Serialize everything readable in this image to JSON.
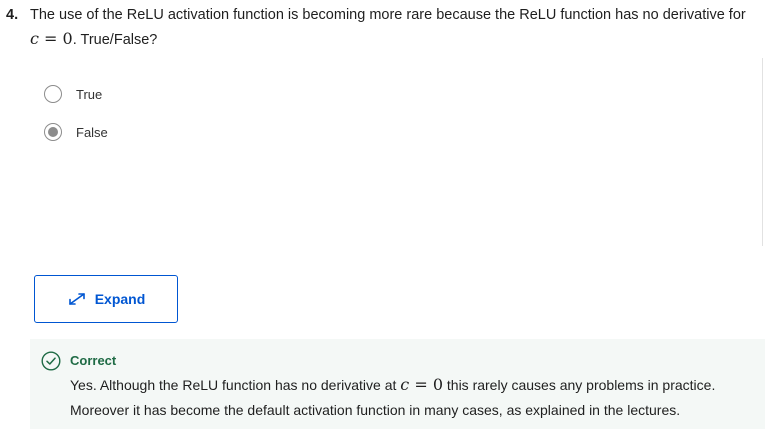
{
  "question": {
    "number": "4.",
    "text_before": "The use of the ReLU activation function is becoming more rare because the ReLU function has no derivative for",
    "math_var": "c",
    "math_eq": " = ",
    "math_val": "0",
    "text_after": ". True/False?"
  },
  "options": [
    {
      "label": "True",
      "selected": false
    },
    {
      "label": "False",
      "selected": true
    }
  ],
  "expand_button": {
    "label": "Expand",
    "icon": "expand-arrows-icon"
  },
  "feedback": {
    "status": "Correct",
    "text_before": "Yes. Although the ReLU function has no derivative at",
    "math_var": "c",
    "math_eq": " = ",
    "math_val": "0",
    "text_after": "this rarely causes any problems in practice. Moreover it has become the default activation function in many cases, as explained in the lectures."
  },
  "colors": {
    "accent": "#0056d2",
    "correct_green": "#1f6b45",
    "feedback_bg": "#f4f8f6",
    "radio_gray": "#8c8c8c"
  }
}
